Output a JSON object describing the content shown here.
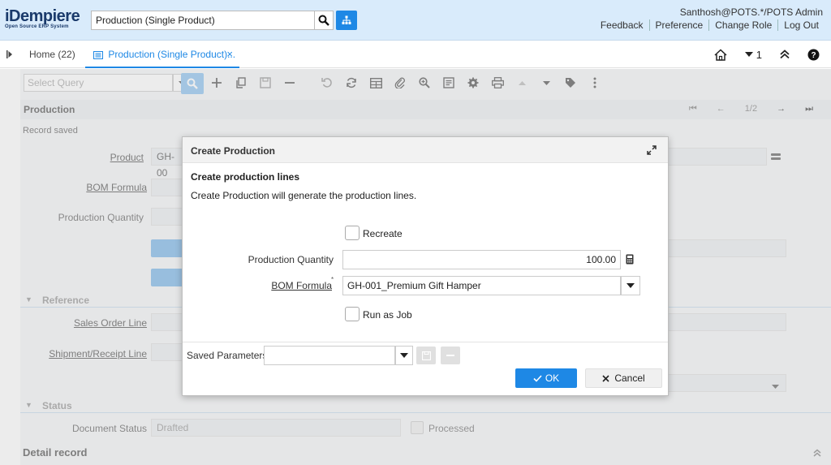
{
  "header": {
    "logo_main": "iDempiere",
    "logo_sub": "Open Source ERP System",
    "menu_search_value": "Production (Single Product)",
    "user": "Santhosh@POTS.*/POTS Admin",
    "links": [
      "Feedback",
      "Preference",
      "Change Role",
      "Log Out"
    ]
  },
  "tabs": {
    "home": "Home (22)",
    "active": "Production (Single Product)...",
    "close": "×",
    "window_count": "1"
  },
  "window": {
    "query_placeholder": "Select Query",
    "section_title": "Production",
    "nav_page": "1/2",
    "record_status": "Record saved",
    "fields": {
      "product_label": "Product",
      "product_value": "GH-00",
      "bom_label": "BOM Formula",
      "qty_label": "Production Quantity",
      "sales_order_line_label": "Sales Order Line",
      "shipment_label": "Shipment/Receipt Line",
      "doc_status_label": "Document Status",
      "doc_status_value": "Drafted",
      "processed_label": "Processed"
    },
    "groups": {
      "reference": "Reference",
      "status": "Status"
    },
    "detail_record": "Detail record"
  },
  "dialog": {
    "title": "Create Production",
    "heading": "Create production lines",
    "description": "Create Production will generate the production lines.",
    "recreate_label": "Recreate",
    "qty_label": "Production Quantity",
    "qty_value": "100.00",
    "bom_label": "BOM Formula",
    "bom_value": "GH-001_Premium Gift Hamper",
    "run_as_job_label": "Run as Job",
    "saved_params_label": "Saved Parameters",
    "ok_label": "OK",
    "cancel_label": "Cancel"
  },
  "colors": {
    "accent": "#1e88e5",
    "header_bg": "#d9ebfb"
  }
}
